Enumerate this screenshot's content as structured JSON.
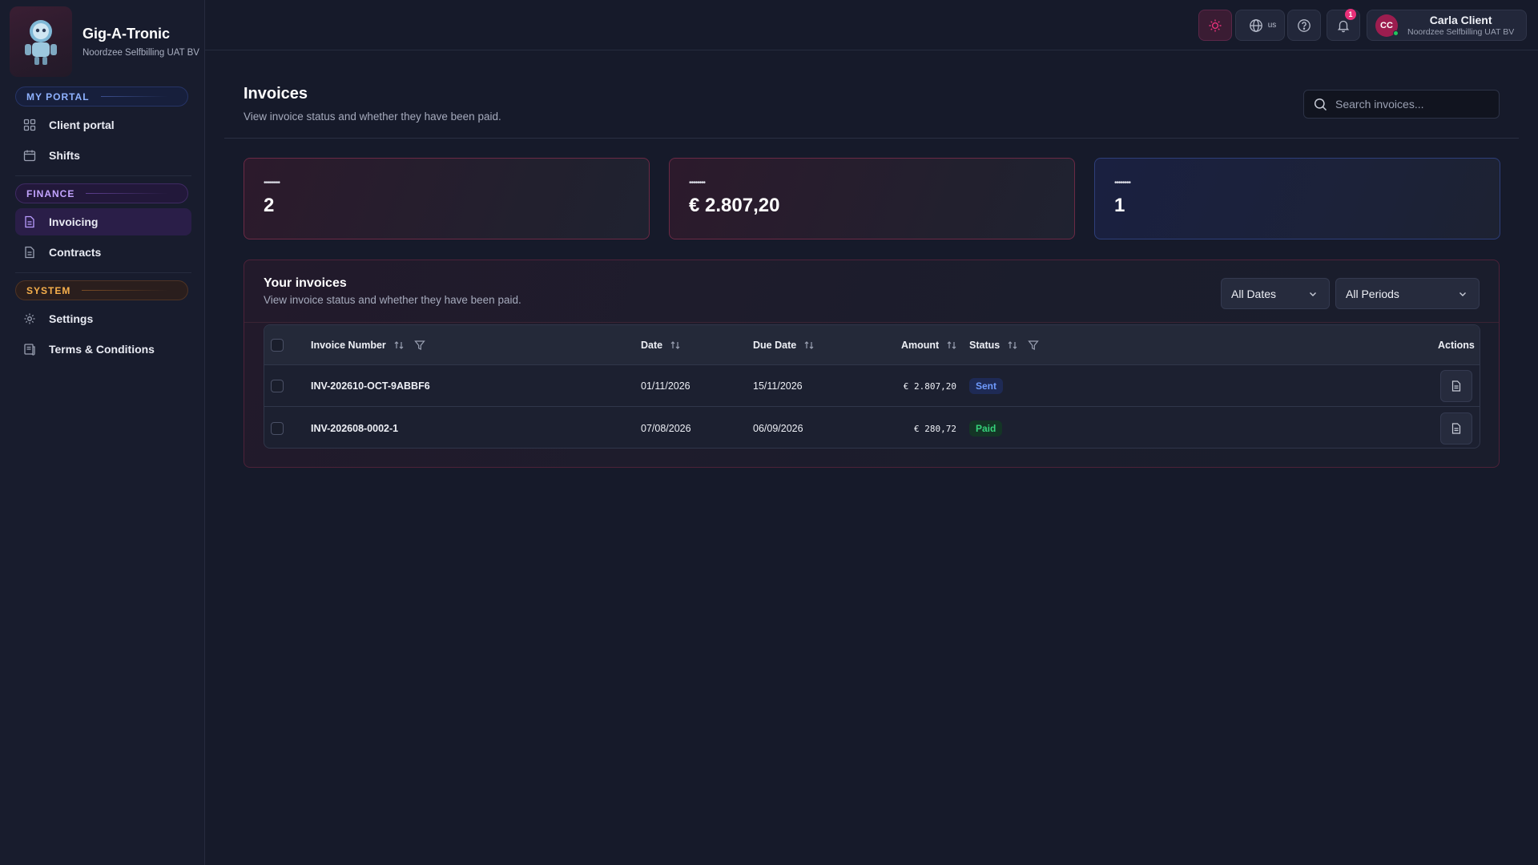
{
  "brand": {
    "name": "Gig-A-Tronic",
    "org": "Noordzee Selfbilling UAT BV"
  },
  "sidebar": {
    "sections": [
      {
        "label": "MY PORTAL"
      },
      {
        "label": "FINANCE"
      },
      {
        "label": "SYSTEM"
      }
    ],
    "items": [
      {
        "label": "Client portal",
        "icon": "grid-icon"
      },
      {
        "label": "Shifts",
        "icon": "calendar-icon"
      },
      {
        "label": "Invoicing",
        "icon": "document-icon",
        "active": true
      },
      {
        "label": "Contracts",
        "icon": "document-icon"
      },
      {
        "label": "Settings",
        "icon": "gear-icon"
      },
      {
        "label": "Terms & Conditions",
        "icon": "scroll-icon"
      }
    ]
  },
  "topbar": {
    "language": "us",
    "notification_count": "1",
    "user": {
      "initials": "CC",
      "name": "Carla Client",
      "org": "Noordzee Selfbilling UAT BV"
    }
  },
  "page": {
    "title": "Invoices",
    "subtitle": "View invoice status and whether they have been paid.",
    "search_placeholder": "Search invoices..."
  },
  "stats": [
    {
      "label": "••••••••",
      "value": "2"
    },
    {
      "label": "••••••••",
      "value": "€ 2.807,20"
    },
    {
      "label": "••••••••",
      "value": "1"
    }
  ],
  "panel": {
    "title": "Your invoices",
    "subtitle": "View invoice status and whether they have been paid.",
    "date_filter": "All Dates",
    "period_filter": "All Periods"
  },
  "table": {
    "columns": {
      "invoice_number": "Invoice Number",
      "date": "Date",
      "due_date": "Due Date",
      "amount": "Amount",
      "status": "Status",
      "actions": "Actions"
    },
    "rows": [
      {
        "invoice_number": "INV-202610-OCT-9ABBF6",
        "date": "01/11/2026",
        "due_date": "15/11/2026",
        "amount": "€ 2.807,20",
        "status": "Sent"
      },
      {
        "invoice_number": "INV-202608-0002-1",
        "date": "07/08/2026",
        "due_date": "06/09/2026",
        "amount": "€ 280,72",
        "status": "Paid"
      }
    ]
  },
  "colors": {
    "background": "#161a2a",
    "accent_pink": "#e8317a",
    "status_sent": "#6f9bff",
    "status_paid": "#36d27a"
  }
}
